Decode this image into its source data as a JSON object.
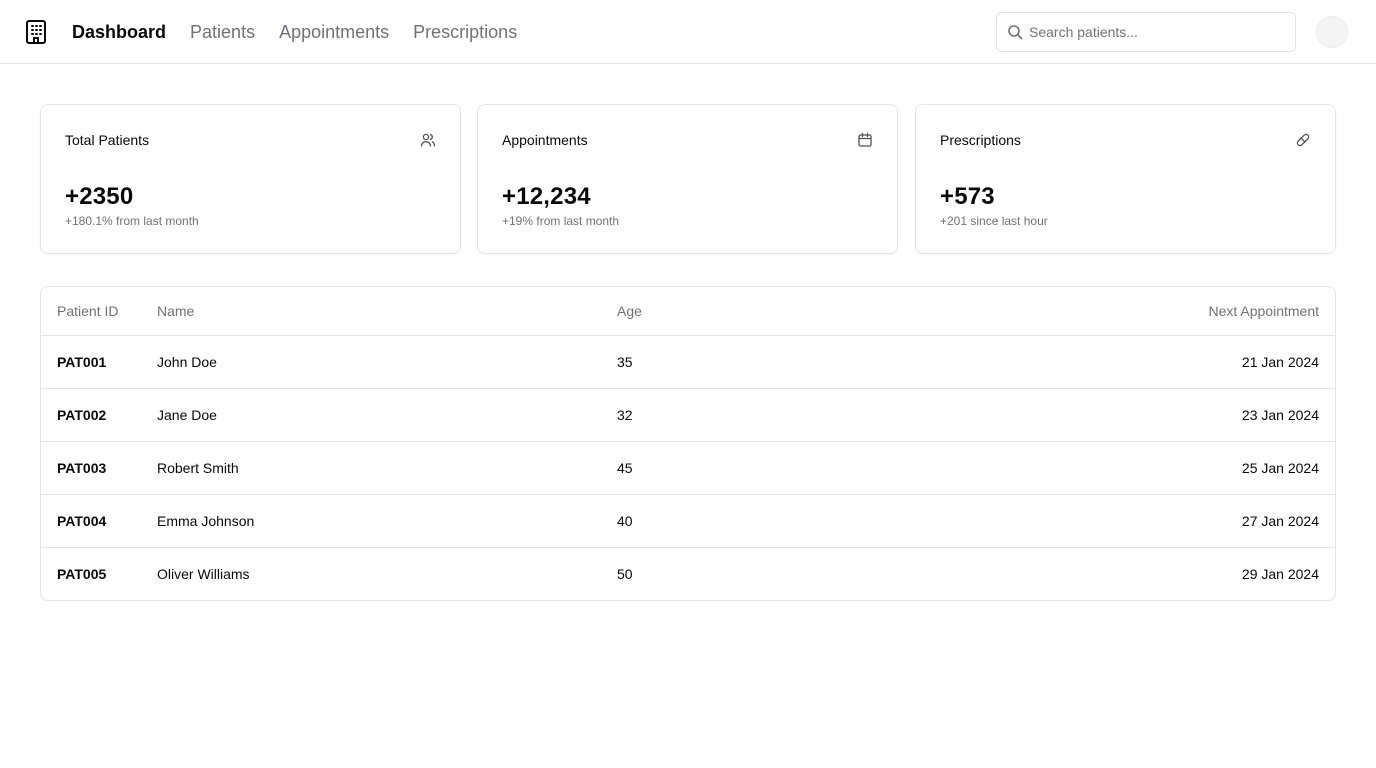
{
  "nav": {
    "items": [
      {
        "label": "Dashboard",
        "active": true
      },
      {
        "label": "Patients",
        "active": false
      },
      {
        "label": "Appointments",
        "active": false
      },
      {
        "label": "Prescriptions",
        "active": false
      }
    ]
  },
  "search": {
    "placeholder": "Search patients...",
    "value": ""
  },
  "icons": {
    "logo": "hospital-building-icon",
    "search": "search-icon",
    "patients": "users-icon",
    "appointments": "calendar-icon",
    "prescriptions": "pill-icon"
  },
  "stats": [
    {
      "title": "Total Patients",
      "value": "+2350",
      "delta": "+180.1% from last month"
    },
    {
      "title": "Appointments",
      "value": "+12,234",
      "delta": "+19% from last month"
    },
    {
      "title": "Prescriptions",
      "value": "+573",
      "delta": "+201 since last hour"
    }
  ],
  "table": {
    "headers": [
      "Patient ID",
      "Name",
      "Age",
      "Next Appointment"
    ],
    "rows": [
      {
        "id": "PAT001",
        "name": "John Doe",
        "age": "35",
        "next": "21 Jan 2024"
      },
      {
        "id": "PAT002",
        "name": "Jane Doe",
        "age": "32",
        "next": "23 Jan 2024"
      },
      {
        "id": "PAT003",
        "name": "Robert Smith",
        "age": "45",
        "next": "25 Jan 2024"
      },
      {
        "id": "PAT004",
        "name": "Emma Johnson",
        "age": "40",
        "next": "27 Jan 2024"
      },
      {
        "id": "PAT005",
        "name": "Oliver Williams",
        "age": "50",
        "next": "29 Jan 2024"
      }
    ]
  },
  "colors": {
    "text": "#09090b",
    "muted": "#71717a",
    "border": "#e4e4e7"
  }
}
